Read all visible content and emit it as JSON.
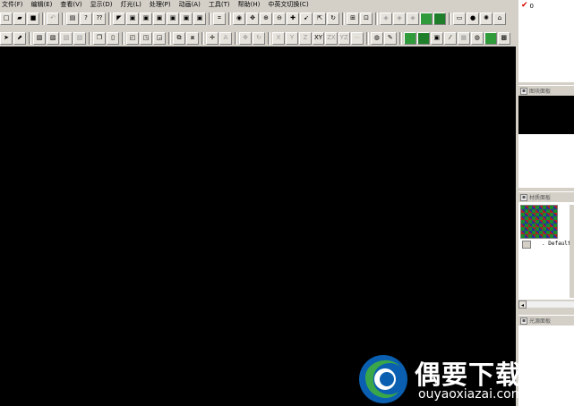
{
  "menu": [
    "文件(F)",
    "编辑(E)",
    "查看(V)",
    "显示(D)",
    "灯光(L)",
    "处理(P)",
    "动画(A)",
    "工具(T)",
    "帮助(H)",
    "中英文切换(C)"
  ],
  "toolbar_axes": [
    "X",
    "Y",
    "Z",
    "XY",
    "ZX",
    "YZ"
  ],
  "layers_panel": {
    "item": "0"
  },
  "block_panel": {
    "title": "图块面板"
  },
  "material_panel": {
    "title": "材质面板",
    "item": "Default"
  },
  "light_panel": {
    "title": "光源面板"
  },
  "watermark": {
    "title": "偶要下载站",
    "subtitle": "ouyaoxiazai.com"
  },
  "colors": {
    "viewport": "#000000",
    "chrome": "#d4d0c8",
    "accent_green": "#2f9b3a"
  }
}
